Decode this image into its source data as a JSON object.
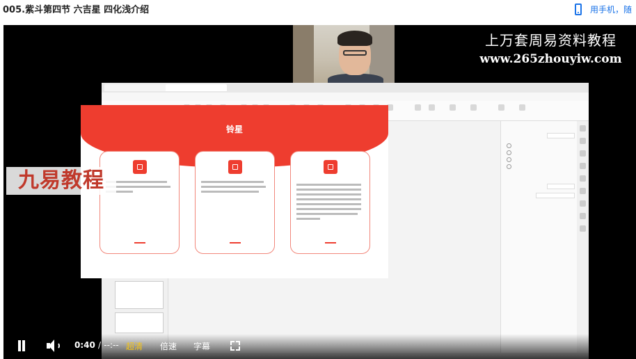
{
  "page": {
    "title": "005.紫斗第四节 六吉星 四化浅介绍",
    "mobile_link": "用手机，随"
  },
  "video": {
    "watermark_line1": "上万套周易资料教程",
    "watermark_line2": "www.265zhouyiw.com",
    "logo_text": "九易教程",
    "slide_title": "铃星"
  },
  "controls": {
    "current_time": "0:40",
    "separator": "/",
    "duration": "--:--",
    "quality": "超清",
    "speed": "倍速",
    "subtitles": "字幕"
  },
  "colors": {
    "slide_accent": "#ee3d2f",
    "quality_highlight": "#f5c518",
    "link": "#1a73e8"
  },
  "icons": [
    "phone-icon",
    "pause-icon",
    "volume-icon",
    "fullscreen-icon"
  ]
}
